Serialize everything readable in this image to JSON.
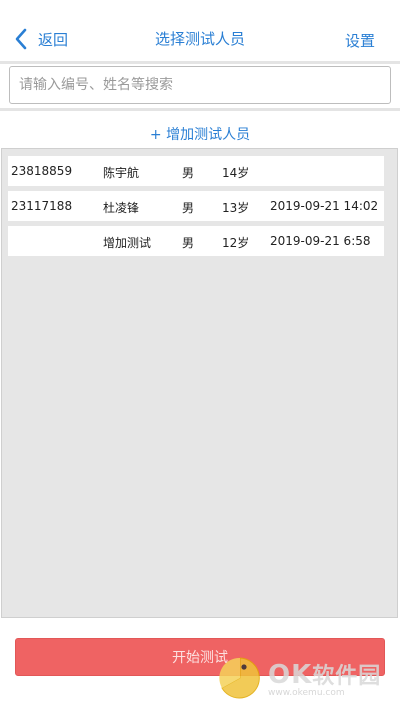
{
  "nav": {
    "back_label": "返回",
    "title": "选择测试人员",
    "settings_label": "设置"
  },
  "search": {
    "placeholder": "请输入编号、姓名等搜索",
    "value": ""
  },
  "add_person_label": "+ 增加测试人员",
  "people": [
    {
      "id": "23818859",
      "name": "陈宇航",
      "gender": "男",
      "age": "14岁",
      "time": ""
    },
    {
      "id": "23117188",
      "name": "杜凌锋",
      "gender": "男",
      "age": "13岁",
      "time": "2019-09-21 14:02"
    },
    {
      "id": "",
      "name": "增加测试",
      "gender": "男",
      "age": "12岁",
      "time": "2019-09-21 6:58"
    }
  ],
  "start_button_label": "开始测试",
  "watermark": {
    "brand": "OK",
    "brand_cn": "软件园",
    "url": "www.okemu.com"
  },
  "colors": {
    "accent": "#2a7fd4",
    "start_button": "#ef6363",
    "list_background": "#e6e6e6"
  }
}
